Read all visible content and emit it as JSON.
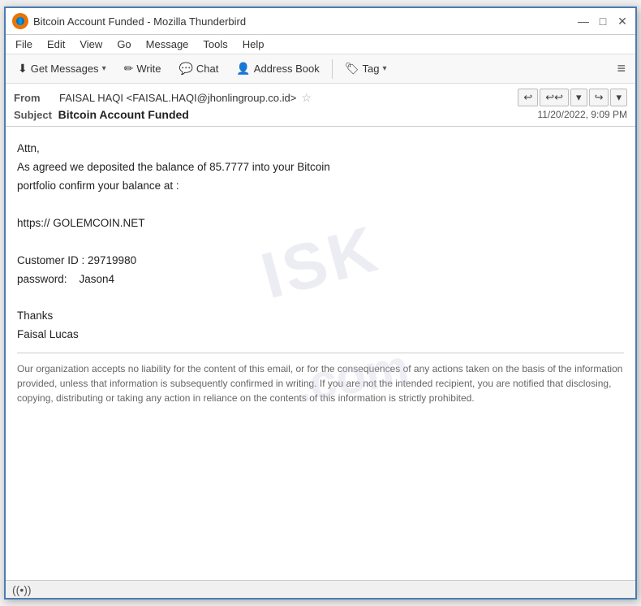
{
  "window": {
    "title": "Bitcoin Account Funded - Mozilla Thunderbird",
    "logo_text": "T",
    "controls": {
      "minimize": "—",
      "maximize": "□",
      "close": "✕"
    }
  },
  "menu": {
    "items": [
      "File",
      "Edit",
      "View",
      "Go",
      "Message",
      "Tools",
      "Help"
    ]
  },
  "toolbar": {
    "get_messages_label": "Get Messages",
    "write_label": "Write",
    "chat_label": "Chat",
    "address_book_label": "Address Book",
    "tag_label": "Tag",
    "hamburger": "≡"
  },
  "email_header": {
    "from_label": "From",
    "from_value": "FAISAL HAQI <FAISAL.HAQI@jhonlingroup.co.id>",
    "subject_label": "Subject",
    "subject_value": "Bitcoin Account Funded",
    "date_value": "11/20/2022, 9:09 PM"
  },
  "email_body": {
    "content": "Attn,\nAs agreed we deposited the balance of 85.7777 into your Bitcoin\nportfolio confirm your balance at :\n\nhttps:// GOLEMCOIN.NET\n\nCustomer ID : 29719980\npassword:    Jason4\n\nThanks\nFaisal Lucas",
    "disclaimer": "Our organization accepts no liability for the content of this email, or for the consequences of any actions taken on the basis of the information provided, unless that information is subsequently confirmed in writing. If you are not the intended recipient, you are notified that disclosing, copying, distributing or taking any action in reliance on the contents of this information is strictly prohibited."
  },
  "status_bar": {
    "icon": "((•))"
  },
  "watermark1": "ISK",
  "watermark2": ".com"
}
